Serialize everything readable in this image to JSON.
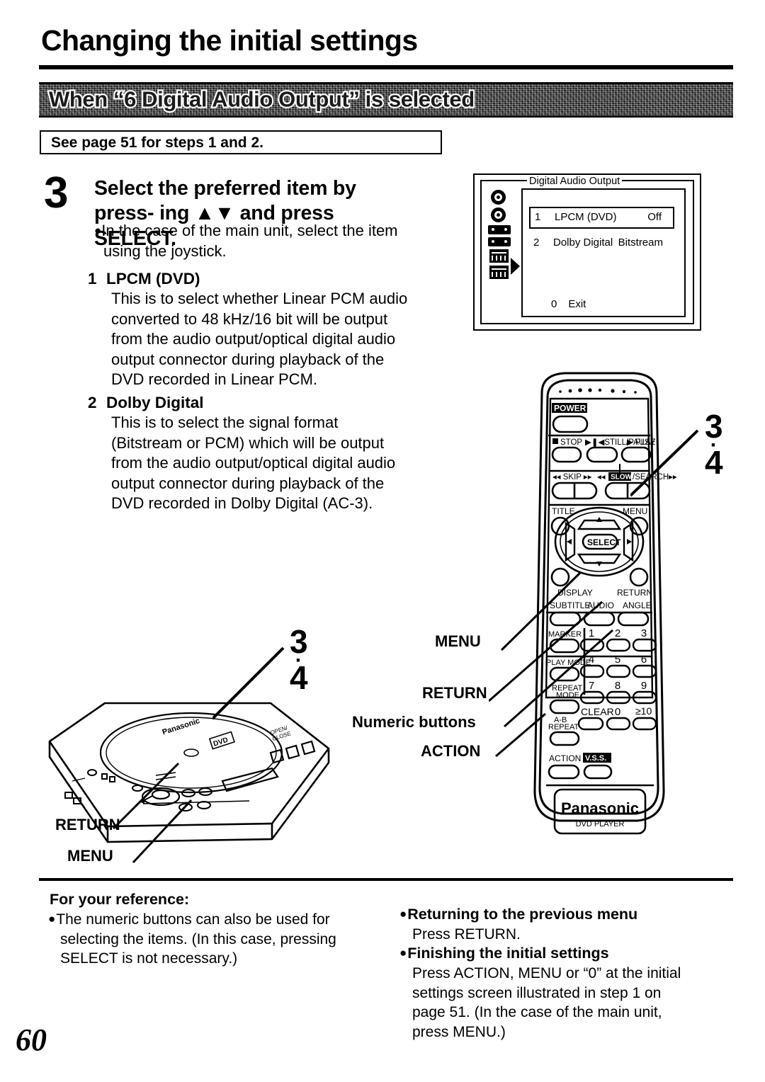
{
  "page": {
    "title": "Changing the initial settings",
    "number": "60"
  },
  "banner": {
    "text": "When “6 Digital Audio Output” is selected"
  },
  "see_page_box": {
    "text": "See page 51 for steps 1 and 2."
  },
  "step": {
    "number": "3",
    "heading_line1": "Select the preferred item by press-",
    "heading_line2": "ing ▲▼ and press SELECT.",
    "note_line1": "In the case of the main unit, select the item",
    "note_line2": "using the joystick."
  },
  "items": [
    {
      "number": "1",
      "title": "LPCM (DVD)",
      "body_lines": [
        "This is to select whether Linear PCM audio",
        "converted to 48 kHz/16 bit will be output",
        "from the audio output/optical digital audio",
        "output connector during playback of the",
        "DVD recorded in Linear PCM."
      ]
    },
    {
      "number": "2",
      "title": "Dolby Digital",
      "body_lines": [
        "This is to select the signal format",
        "(Bitstream or PCM) which will be output",
        "from the audio output/optical digital audio",
        "output connector during playback of the",
        "DVD recorded in Dolby Digital (AC-3)."
      ]
    }
  ],
  "osd": {
    "title": "Digital Audio Output",
    "rows": [
      {
        "num": "1",
        "label": "LPCM (DVD)",
        "value": "Off"
      },
      {
        "num": "2",
        "label": "Dolby Digital",
        "value": "Bitstream"
      }
    ],
    "exit_num": "0",
    "exit_label": "Exit"
  },
  "remote": {
    "power": "POWER",
    "stop": "STOP",
    "still_pause": "STILL/PAUSE",
    "play": "PLAY",
    "skip": "SKIP",
    "slow": "SLOW",
    "search": "/SEARCH",
    "title": "TITLE",
    "menu": "MENU",
    "select": "SELECT",
    "display": "DISPLAY",
    "return": "RETURN",
    "subtitle": "SUBTITLE",
    "audio": "AUDIO",
    "angle": "ANGLE",
    "marker": "MARKER",
    "play_mode": "PLAY MODE",
    "repeat_mode": "REPEAT MODE",
    "ab_repeat": "A-B REPEAT",
    "clear": "CLEAR",
    "over_ten": "≥10",
    "action": "ACTION",
    "vss": "V.S.S.",
    "brand": "Panasonic",
    "product": "DVD PLAYER",
    "numeric_keys": [
      "1",
      "2",
      "3",
      "4",
      "5",
      "6",
      "7",
      "8",
      "9",
      "0"
    ]
  },
  "callouts": {
    "menu": "MENU",
    "return": "RETURN",
    "numeric_buttons": "Numeric buttons",
    "action": "ACTION",
    "unit_return": "RETURN",
    "unit_menu": "MENU"
  },
  "step_markers": {
    "top": "3",
    "dot": "·",
    "bottom": "4"
  },
  "footer": {
    "heading": "For your reference:",
    "left_lines": [
      "The numeric buttons can also be used for",
      "selecting the items. (In this case, pressing",
      "SELECT is not necessary.)"
    ],
    "right": [
      {
        "head": "Returning to the previous menu",
        "body_lines": [
          "Press RETURN."
        ]
      },
      {
        "head": "Finishing the initial settings",
        "body_lines": [
          "Press ACTION, MENU or “0” at the initial",
          "settings screen illustrated in step 1 on",
          "page 51. (In the case of the main unit,",
          "press MENU.)"
        ]
      }
    ]
  }
}
